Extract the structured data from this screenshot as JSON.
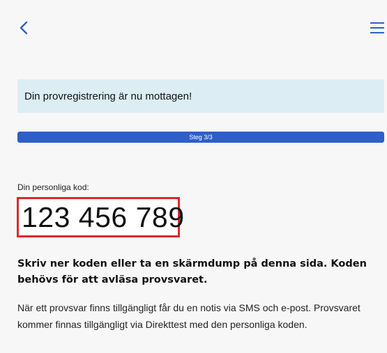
{
  "nav": {
    "back_icon": "chevron-left-icon",
    "menu_icon": "hamburger-menu-icon",
    "accent_color": "#2e5fc7"
  },
  "alert": {
    "message": "Din provregistrering är nu mottagen!",
    "background_color": "#dcedf4"
  },
  "progress": {
    "label": "Steg 3/3",
    "current_step": 3,
    "total_steps": 3,
    "fill_fraction": 1.0
  },
  "code": {
    "label": "Din personliga kod:",
    "value": "123 456 789",
    "highlight_color": "#e1262c"
  },
  "instruction": {
    "text": "Skriv ner koden eller ta en skärmdump på denna sida. Koden behövs för att avläsa provsvaret."
  },
  "info": {
    "text": "När ett provsvar finns tillgängligt får du en notis via SMS och e-post. Provsvaret kommer finnas tillgängligt via Direkttest med den personliga koden."
  }
}
